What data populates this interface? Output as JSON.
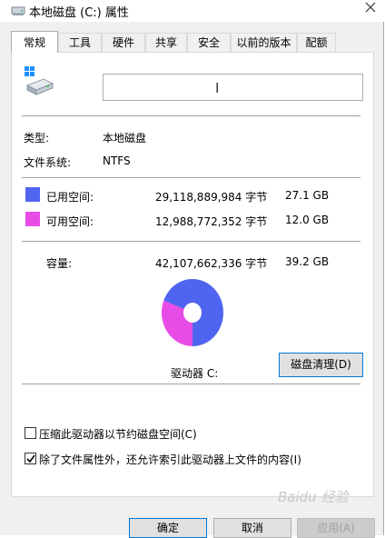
{
  "window": {
    "title": "本地磁盘 (C:) 属性",
    "icon": "drive-icon",
    "close_icon": "close-icon"
  },
  "tabs": [
    {
      "label": "常规",
      "active": true
    },
    {
      "label": "工具"
    },
    {
      "label": "硬件"
    },
    {
      "label": "共享"
    },
    {
      "label": "安全"
    },
    {
      "label": "以前的版本"
    },
    {
      "label": "配额"
    }
  ],
  "general": {
    "drive_name_value": "",
    "type_label": "类型:",
    "type_value": "本地磁盘",
    "fs_label": "文件系统:",
    "fs_value": "NTFS",
    "used": {
      "label": "已用空间:",
      "bytes": "29,118,889,984 字节",
      "size": "27.1 GB",
      "color": "#4f65f0"
    },
    "free": {
      "label": "可用空间:",
      "bytes": "12,988,772,352 字节",
      "size": "12.0 GB",
      "color": "#e84ce6"
    },
    "capacity": {
      "label": "容量:",
      "bytes": "42,107,662,336 字节",
      "size": "39.2 GB"
    },
    "drive_label": "驱动器 C:",
    "cleanup_button": "磁盘清理(D)",
    "compress_label": "压缩此驱动器以节约磁盘空间(C)",
    "compress_checked": false,
    "index_label": "除了文件属性外，还允许索引此驱动器上文件的内容(I)",
    "index_checked": true
  },
  "footer": {
    "ok": "确定",
    "cancel": "取消",
    "apply": "应用(A)"
  },
  "watermark": "Baidu 经验"
}
